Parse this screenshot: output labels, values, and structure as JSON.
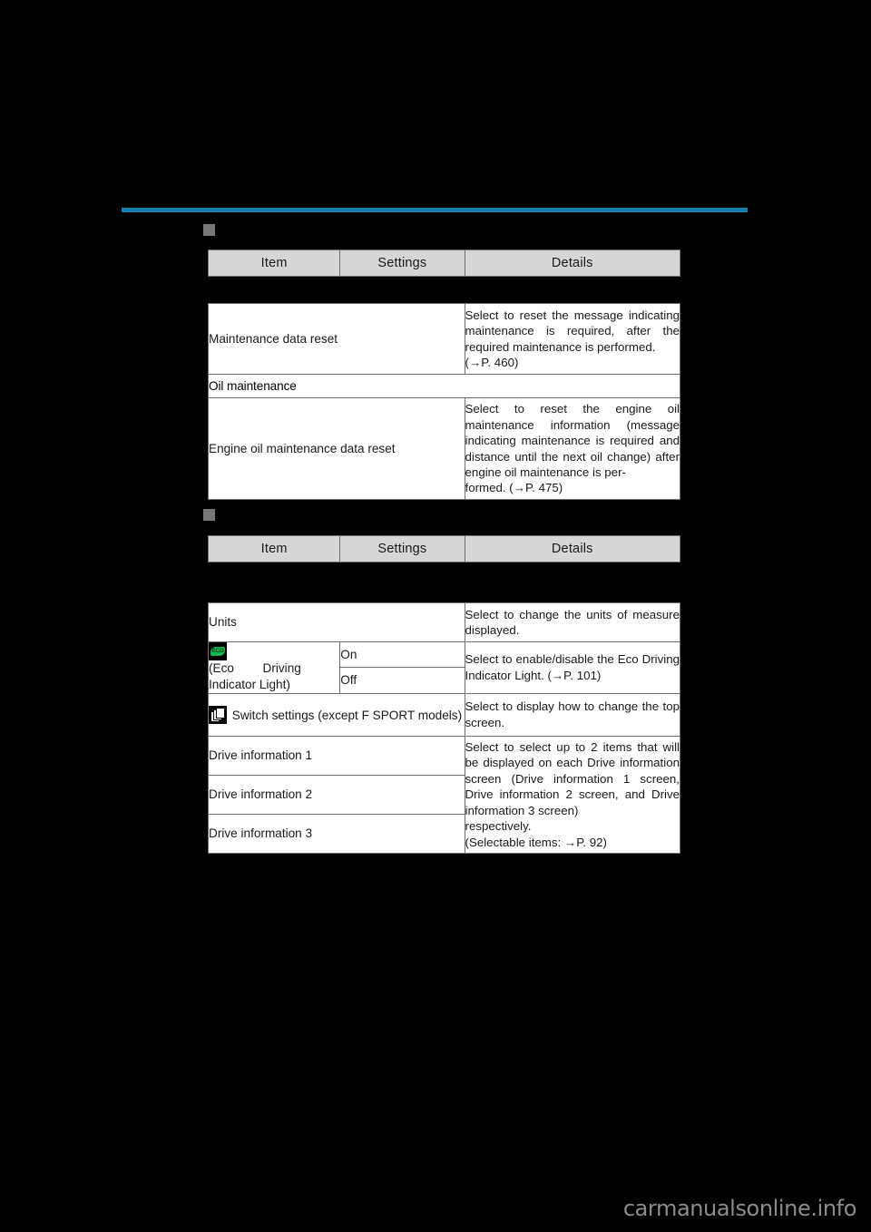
{
  "page": {
    "accent_color": "#1380ae",
    "background_color": "#000000",
    "watermark": "carmanualsonline.info"
  },
  "table_headers": {
    "item": "Item",
    "settings": "Settings",
    "details": "Details"
  },
  "section_1": {
    "rows": [
      {
        "type": "data",
        "item": "Maintenance data reset",
        "settings": "",
        "details": "Select to reset the message indicating maintenance is required, after the required maintenance is performed.",
        "details_ref": "(→P. 460)"
      },
      {
        "type": "group",
        "item": "Oil maintenance"
      },
      {
        "type": "data",
        "item": "Engine oil maintenance data reset",
        "settings": "",
        "details": "Select to reset the engine oil maintenance information (message indicating maintenance is required and distance until the next oil change) after engine oil maintenance is per-",
        "details_ref": "formed. (→P. 475)"
      }
    ]
  },
  "section_2": {
    "rows": [
      {
        "type": "data",
        "item": "Units",
        "details": "Select to change the units of measure displayed."
      },
      {
        "type": "eco",
        "icon": "eco-indicator-icon",
        "icon_label": "ECO",
        "item": "(Eco    Driving Indicator Light)",
        "item_part1": "(Eco",
        "item_part2": "Driving",
        "item_part3": "Indicator Light)",
        "settings_on": "On",
        "settings_off": "Off",
        "details": "Select to enable/disable the Eco Driving Indicator Light. (→P. 101)"
      },
      {
        "type": "switch",
        "icon": "switch-settings-icon",
        "item": "Switch settings (except F SPORT models)",
        "details": "Select to display how to change the top screen."
      },
      {
        "type": "drive",
        "item": "Drive information 1"
      },
      {
        "type": "drive",
        "item": "Drive information 2"
      },
      {
        "type": "drive",
        "item": "Drive information 3"
      }
    ],
    "drive_details": "Select to select up to 2 items that will be displayed on each Drive information screen (Drive information 1 screen, Drive information 2 screen, and Drive information 3 screen)",
    "drive_details_line2": "respectively.",
    "drive_details_line3": "(Selectable items: →P. 92)"
  }
}
